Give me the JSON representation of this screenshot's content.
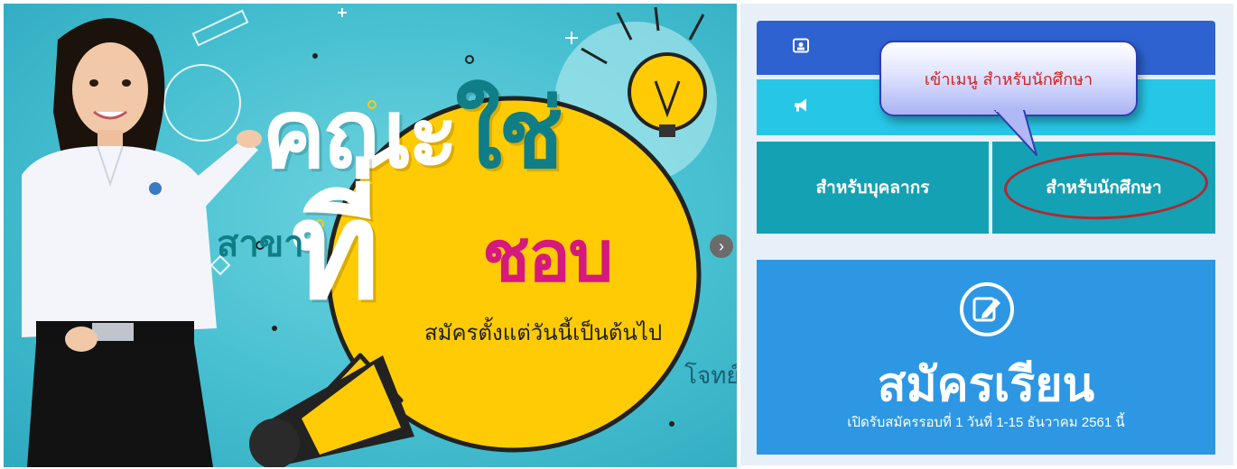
{
  "banner": {
    "headline_line1_white": "คณะ",
    "headline_line1_teal": "ใช่",
    "headline_line2_teal": "สาขา",
    "headline_big_white": "ที่",
    "headline_magenta": "ชอบ",
    "subtitle": "สมัครตั้งแต่วันนี้เป็นต้นไป",
    "cut_text": "โจทย์",
    "next_icon": "chevron-right-icon"
  },
  "menu": {
    "bar1_icon": "id-card-icon",
    "bar1_label": "",
    "bar2_icon": "megaphone-icon",
    "bar2_label": "",
    "tile_staff": "สำหรับบุคลากร",
    "tile_student": "สำหรับนักศึกษา"
  },
  "callout": {
    "text": "เข้าเมนู สำหรับนักศึกษา"
  },
  "register": {
    "icon": "edit-icon",
    "title": "สมัครเรียน",
    "subtitle": "เปิดรับสมัครรอบที่ 1 วันที่ 1-15 ธันวาคม 2561 นี้"
  },
  "colors": {
    "banner_bg": "#46bfd0",
    "bubble_yellow": "#ffcb05",
    "magenta": "#d5197d",
    "menu_blue": "#2d62d0",
    "menu_cyan": "#26c6e6",
    "tile_teal": "#14a1b3",
    "register_blue": "#2d97e4",
    "callout_red_text": "#d42020",
    "annotation_red": "#b3272f"
  }
}
